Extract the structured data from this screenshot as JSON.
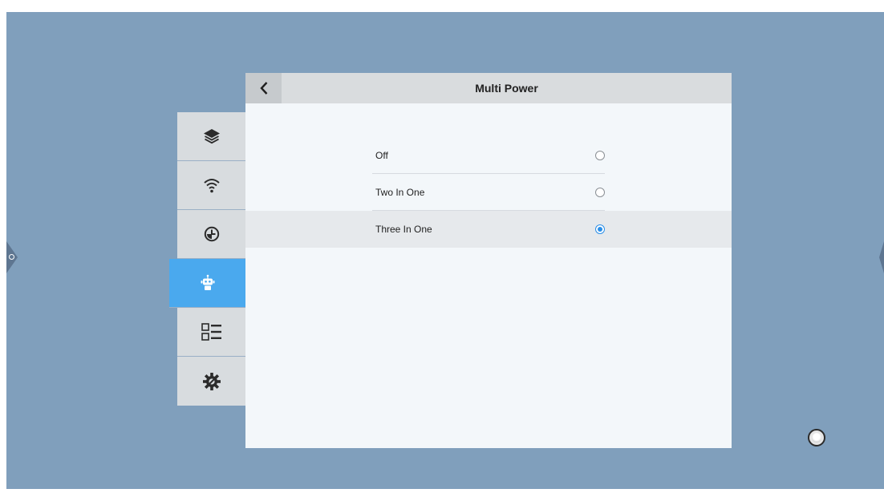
{
  "header": {
    "title": "Multi Power",
    "back_icon": "chevron-left-icon"
  },
  "sidebar": {
    "items": [
      {
        "icon": "layers-icon",
        "active": false
      },
      {
        "icon": "wifi-icon",
        "active": false
      },
      {
        "icon": "clock-icon",
        "active": false
      },
      {
        "icon": "robot-icon",
        "active": true
      },
      {
        "icon": "list-view-icon",
        "active": false
      },
      {
        "icon": "gear-wrench-icon",
        "active": false
      }
    ]
  },
  "options": [
    {
      "label": "Off",
      "selected": false
    },
    {
      "label": "Two In One",
      "selected": false
    },
    {
      "label": "Three In One",
      "selected": true
    }
  ],
  "colors": {
    "accent": "#4aa9ee",
    "desktop": "#809fbc",
    "radio_checked": "#2b8fe8"
  }
}
